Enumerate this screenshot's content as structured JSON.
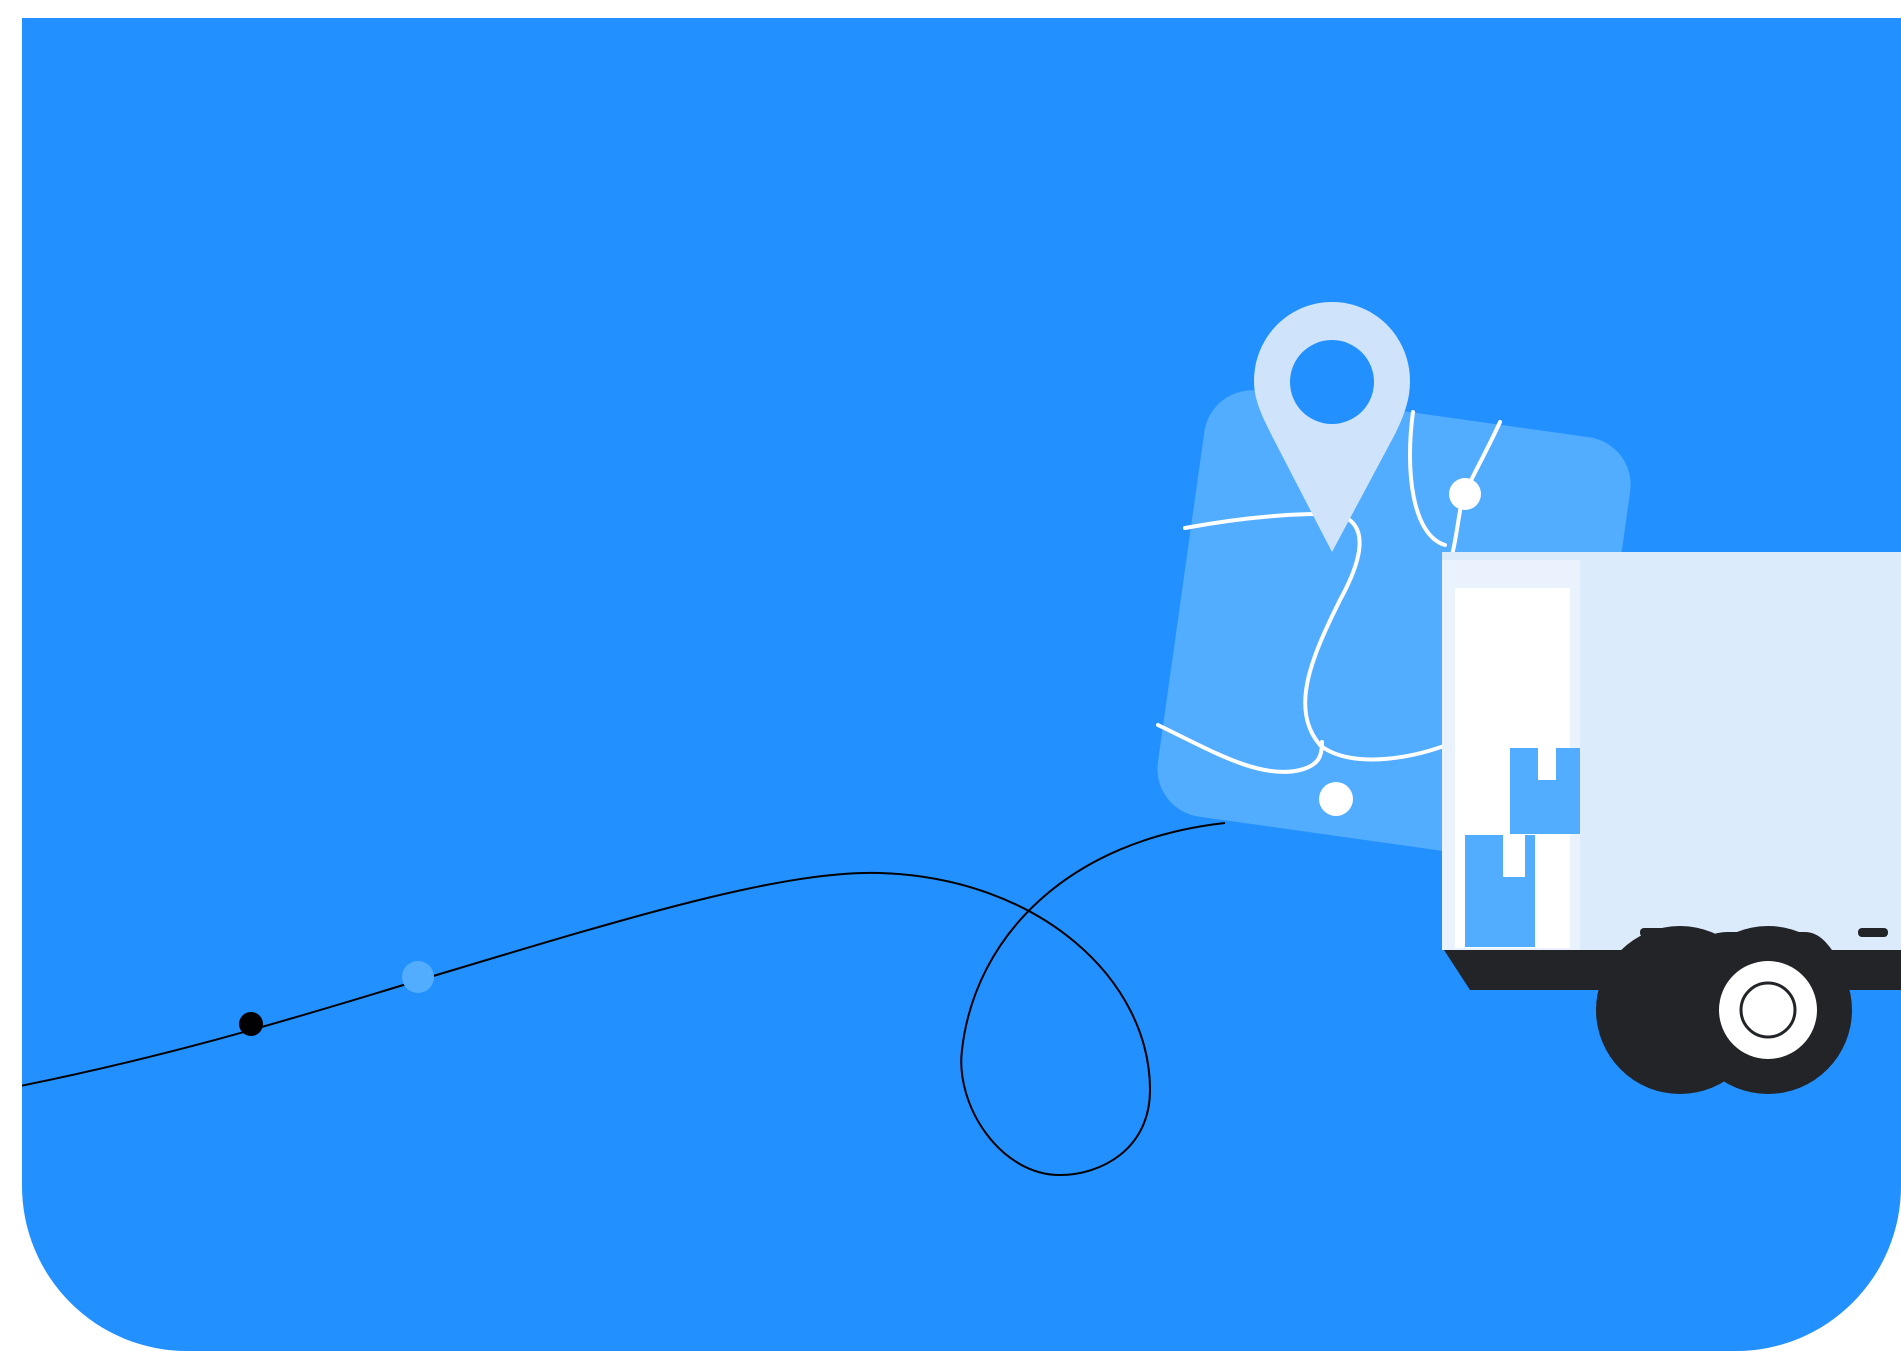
{
  "colors": {
    "background": "#ffffff",
    "panel_blue": "#2291ff",
    "map_card": "#52acff",
    "map_roads": "#ffffff",
    "pin": "#cfe4fb",
    "truck_body_light": "#dcebfb",
    "truck_body_white": "#ffffff",
    "truck_dark": "#222428",
    "path_line": "#000000",
    "path_dot_dark": "#000000",
    "path_dot_light": "#52acff"
  },
  "icons": {
    "map": "map-icon",
    "pin": "location-pin-icon",
    "truck": "delivery-truck-icon"
  }
}
